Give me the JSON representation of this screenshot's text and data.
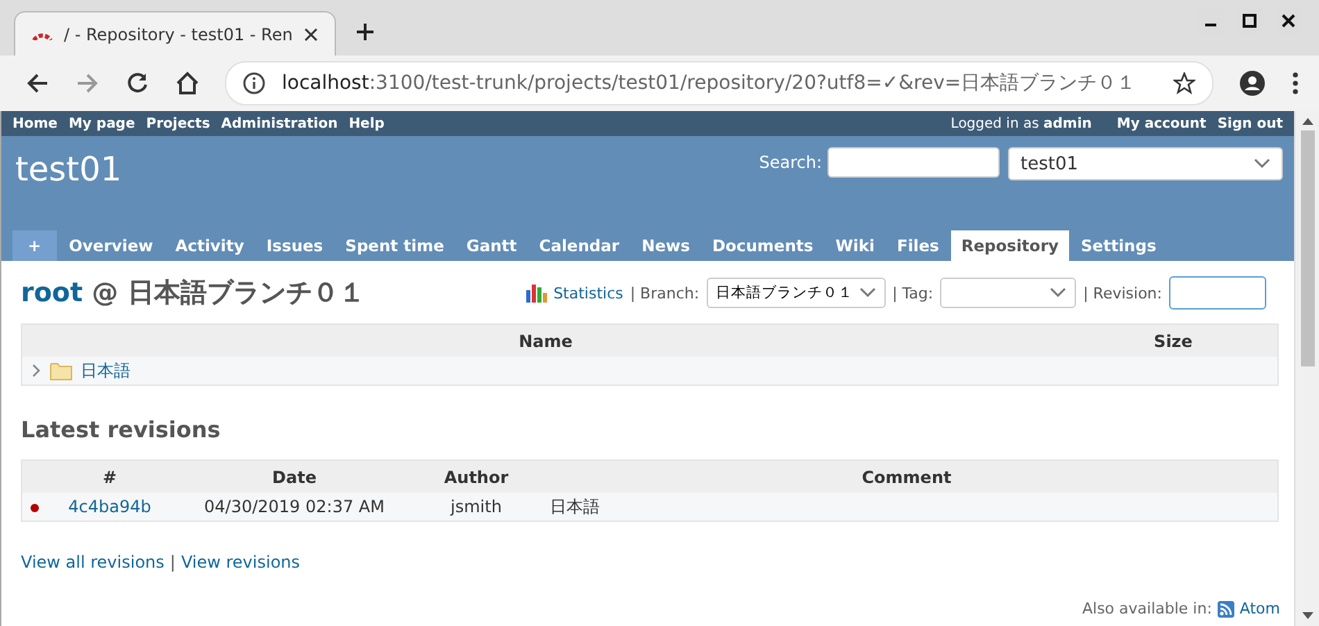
{
  "browser": {
    "tab_title": "/ - Repository - test01 - Ren",
    "url_host": "localhost",
    "url_path": ":3100/test-trunk/projects/test01/repository/20?utf8=✓&rev=日本語ブランチ０１"
  },
  "top_menu": {
    "items": [
      "Home",
      "My page",
      "Projects",
      "Administration",
      "Help"
    ],
    "logged_in": "Logged in as **admin**",
    "account_items": [
      "My account",
      "Sign out"
    ]
  },
  "header": {
    "title": "test01",
    "search_label": "Search:",
    "project_select": "test01"
  },
  "tabs": [
    {
      "label": "+",
      "kind": "new",
      "selected": false
    },
    {
      "label": "Overview",
      "kind": "tab",
      "selected": false
    },
    {
      "label": "Activity",
      "kind": "tab",
      "selected": false
    },
    {
      "label": "Issues",
      "kind": "tab",
      "selected": false
    },
    {
      "label": "Spent time",
      "kind": "tab",
      "selected": false
    },
    {
      "label": "Gantt",
      "kind": "tab",
      "selected": false
    },
    {
      "label": "Calendar",
      "kind": "tab",
      "selected": false
    },
    {
      "label": "News",
      "kind": "tab",
      "selected": false
    },
    {
      "label": "Documents",
      "kind": "tab",
      "selected": false
    },
    {
      "label": "Wiki",
      "kind": "tab",
      "selected": false
    },
    {
      "label": "Files",
      "kind": "tab",
      "selected": false
    },
    {
      "label": "Repository",
      "kind": "tab",
      "selected": true
    },
    {
      "label": "Settings",
      "kind": "tab",
      "selected": false
    }
  ],
  "repository": {
    "root_link": "root",
    "branch_title": "@ 日本語ブランチ０１",
    "statistics_link": "Statistics",
    "branch_label": "| Branch:",
    "branch_select": "日本語ブランチ０１",
    "tag_label": "| Tag:",
    "revision_label": "| Revision:"
  },
  "files_table": {
    "columns": [
      "Name",
      "Size"
    ],
    "rows": [
      {
        "name": "日本語",
        "kind": "folder",
        "expanded": false
      }
    ]
  },
  "latest_revisions": {
    "title": "Latest revisions",
    "columns": [
      "#",
      "Date",
      "Author",
      "Comment"
    ],
    "rows": [
      {
        "revision": "4c4ba94b",
        "date": "04/30/2019 02:37 AM",
        "author": "jsmith",
        "comment": "日本語"
      }
    ]
  },
  "links": {
    "view_all": "View all revisions",
    "separator": "|",
    "view": "View revisions"
  },
  "footer": {
    "also_available": "Also available in:",
    "atom_link": "Atom"
  }
}
